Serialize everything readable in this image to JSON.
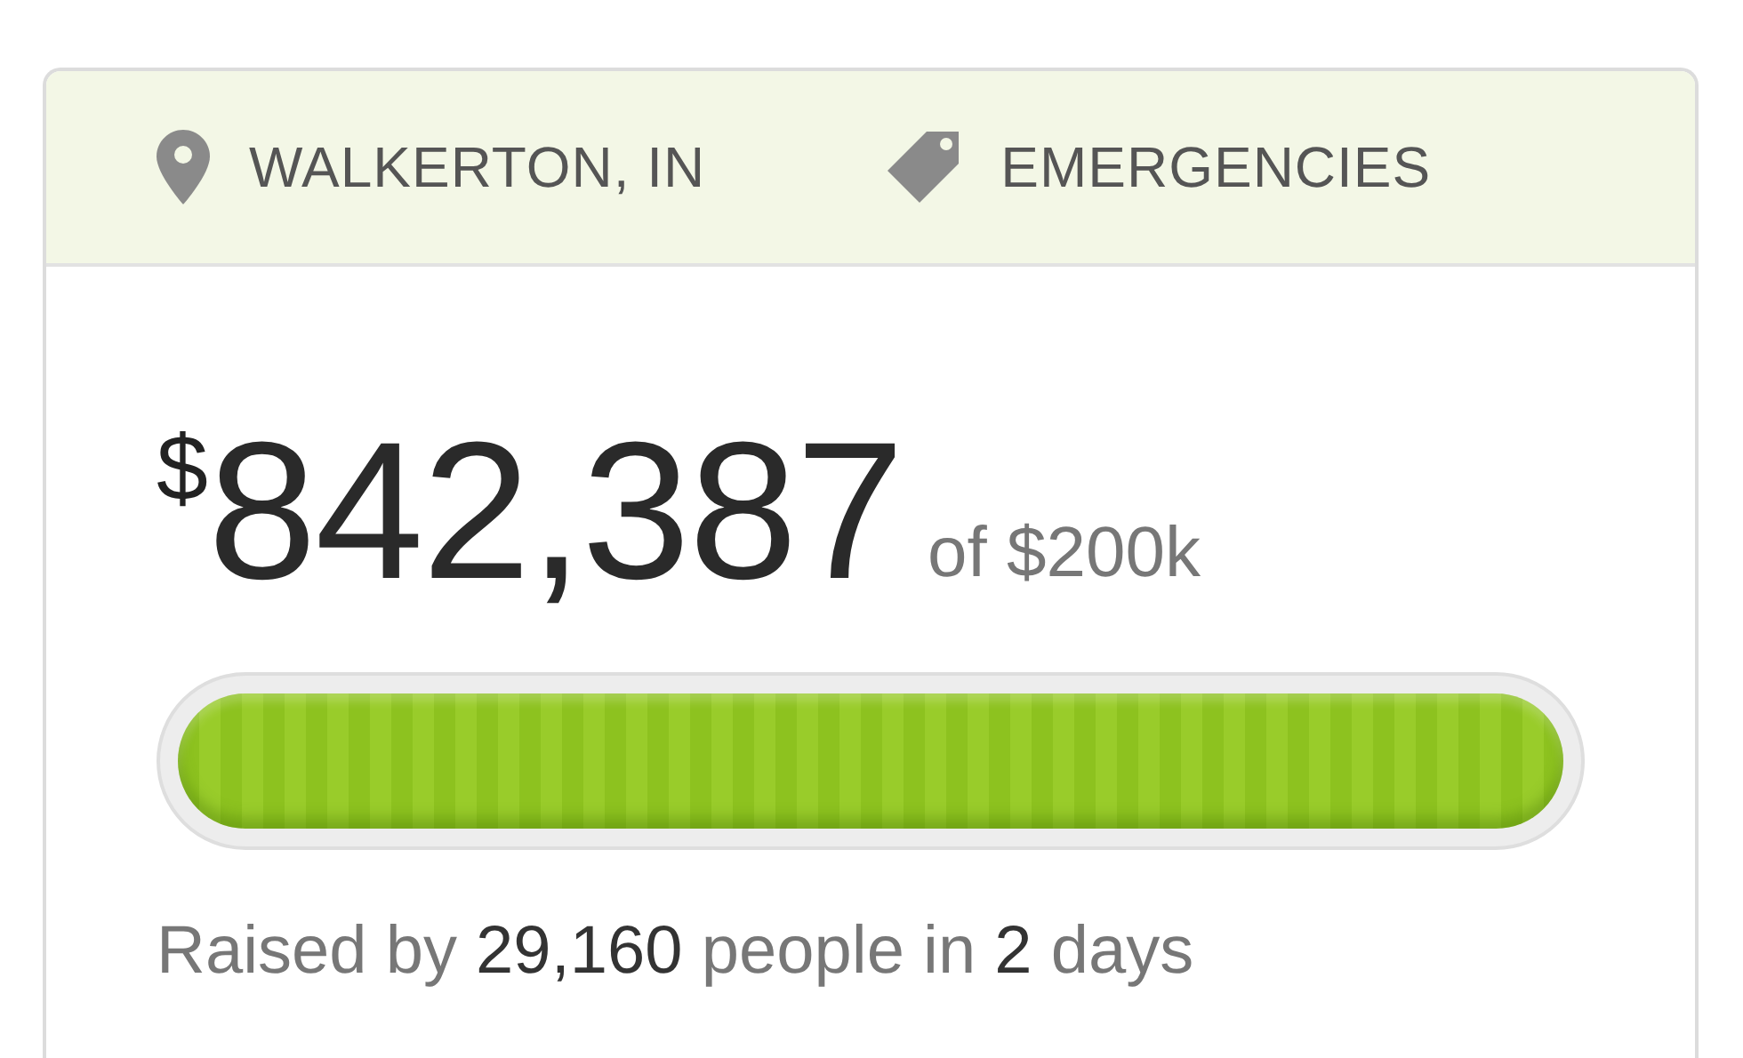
{
  "header": {
    "location": "WALKERTON, IN",
    "category": "EMERGENCIES"
  },
  "raised": {
    "currency": "$",
    "amount": "842,387",
    "goal": "of $200k"
  },
  "progress": {
    "level": 1
  },
  "summary": "Raised by **29,160** people in **2** days"
}
